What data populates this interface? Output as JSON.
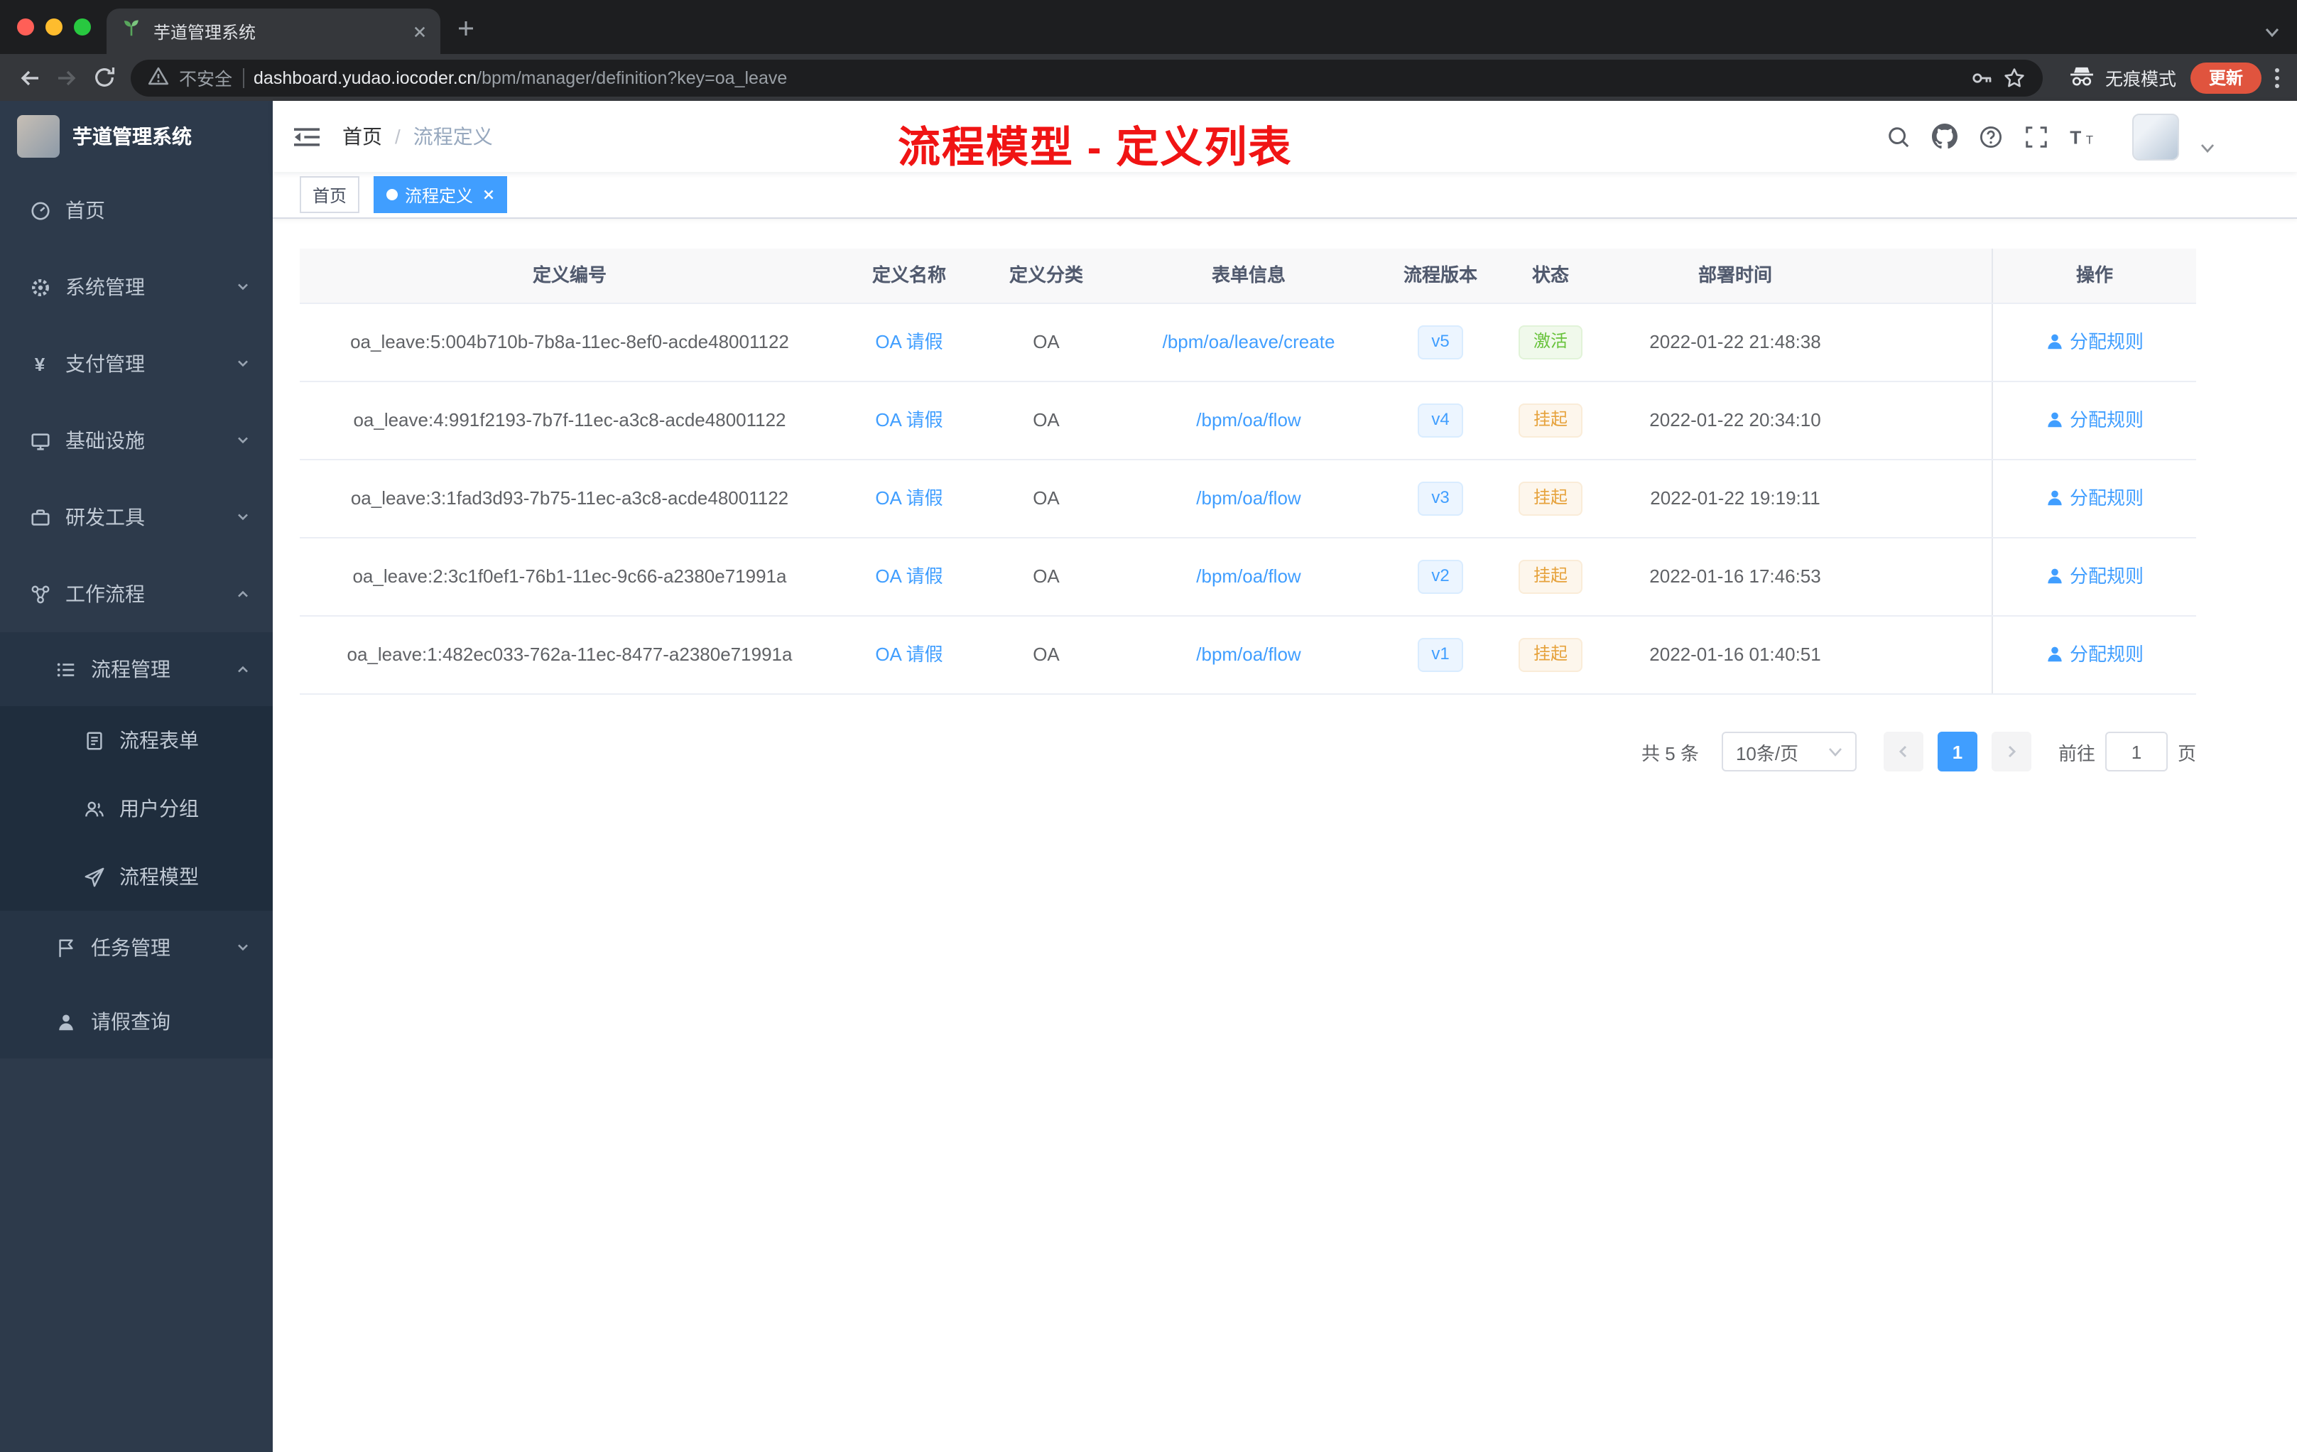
{
  "colors": {
    "accent": "#409eff",
    "success": "#67c23a",
    "warning": "#e6a23c",
    "annotation_red": "#f01414",
    "sidebar_bg": "#2d3a4b"
  },
  "browser": {
    "tab_title": "芋道管理系统",
    "security_label": "不安全",
    "url_host": "dashboard.yudao.iocoder.cn",
    "url_path": "/bpm/manager/definition?key=oa_leave",
    "incognito_label": "无痕模式",
    "update_label": "更新"
  },
  "sidebar": {
    "logo_title": "芋道管理系统",
    "items": [
      {
        "label": "首页",
        "level": 1
      },
      {
        "label": "系统管理",
        "level": 1,
        "chevron": "down"
      },
      {
        "label": "支付管理",
        "level": 1,
        "chevron": "down"
      },
      {
        "label": "基础设施",
        "level": 1,
        "chevron": "down"
      },
      {
        "label": "研发工具",
        "level": 1,
        "chevron": "down"
      },
      {
        "label": "工作流程",
        "level": 1,
        "chevron": "up"
      },
      {
        "label": "流程管理",
        "level": 2,
        "chevron": "up"
      },
      {
        "label": "流程表单",
        "level": 3
      },
      {
        "label": "用户分组",
        "level": 3
      },
      {
        "label": "流程模型",
        "level": 3
      },
      {
        "label": "任务管理",
        "level": 2,
        "chevron": "down"
      },
      {
        "label": "请假查询",
        "level": 2
      }
    ]
  },
  "header": {
    "breadcrumb_home": "首页",
    "breadcrumb_sep": "/",
    "breadcrumb_current": "流程定义",
    "annotation": "流程模型 - 定义列表"
  },
  "tags": {
    "home": "首页",
    "active": "流程定义"
  },
  "table": {
    "columns": [
      "定义编号",
      "定义名称",
      "定义分类",
      "表单信息",
      "流程版本",
      "状态",
      "部署时间",
      "操作"
    ],
    "rows": [
      {
        "id": "oa_leave:5:004b710b-7b8a-11ec-8ef0-acde48001122",
        "name": "OA 请假",
        "category": "OA",
        "form": "/bpm/oa/leave/create",
        "version": "v5",
        "status": "激活",
        "time": "2022-01-22 21:48:38",
        "action": "分配规则"
      },
      {
        "id": "oa_leave:4:991f2193-7b7f-11ec-a3c8-acde48001122",
        "name": "OA 请假",
        "category": "OA",
        "form": "/bpm/oa/flow",
        "version": "v4",
        "status": "挂起",
        "time": "2022-01-22 20:34:10",
        "action": "分配规则"
      },
      {
        "id": "oa_leave:3:1fad3d93-7b75-11ec-a3c8-acde48001122",
        "name": "OA 请假",
        "category": "OA",
        "form": "/bpm/oa/flow",
        "version": "v3",
        "status": "挂起",
        "time": "2022-01-22 19:19:11",
        "action": "分配规则"
      },
      {
        "id": "oa_leave:2:3c1f0ef1-76b1-11ec-9c66-a2380e71991a",
        "name": "OA 请假",
        "category": "OA",
        "form": "/bpm/oa/flow",
        "version": "v2",
        "status": "挂起",
        "time": "2022-01-16 17:46:53",
        "action": "分配规则"
      },
      {
        "id": "oa_leave:1:482ec033-762a-11ec-8477-a2380e71991a",
        "name": "OA 请假",
        "category": "OA",
        "form": "/bpm/oa/flow",
        "version": "v1",
        "status": "挂起",
        "time": "2022-01-16 01:40:51",
        "action": "分配规则"
      }
    ]
  },
  "pagination": {
    "total": "共 5 条",
    "size": "10条/页",
    "page": "1",
    "goto": "前往",
    "goto_value": "1",
    "unit": "页"
  }
}
